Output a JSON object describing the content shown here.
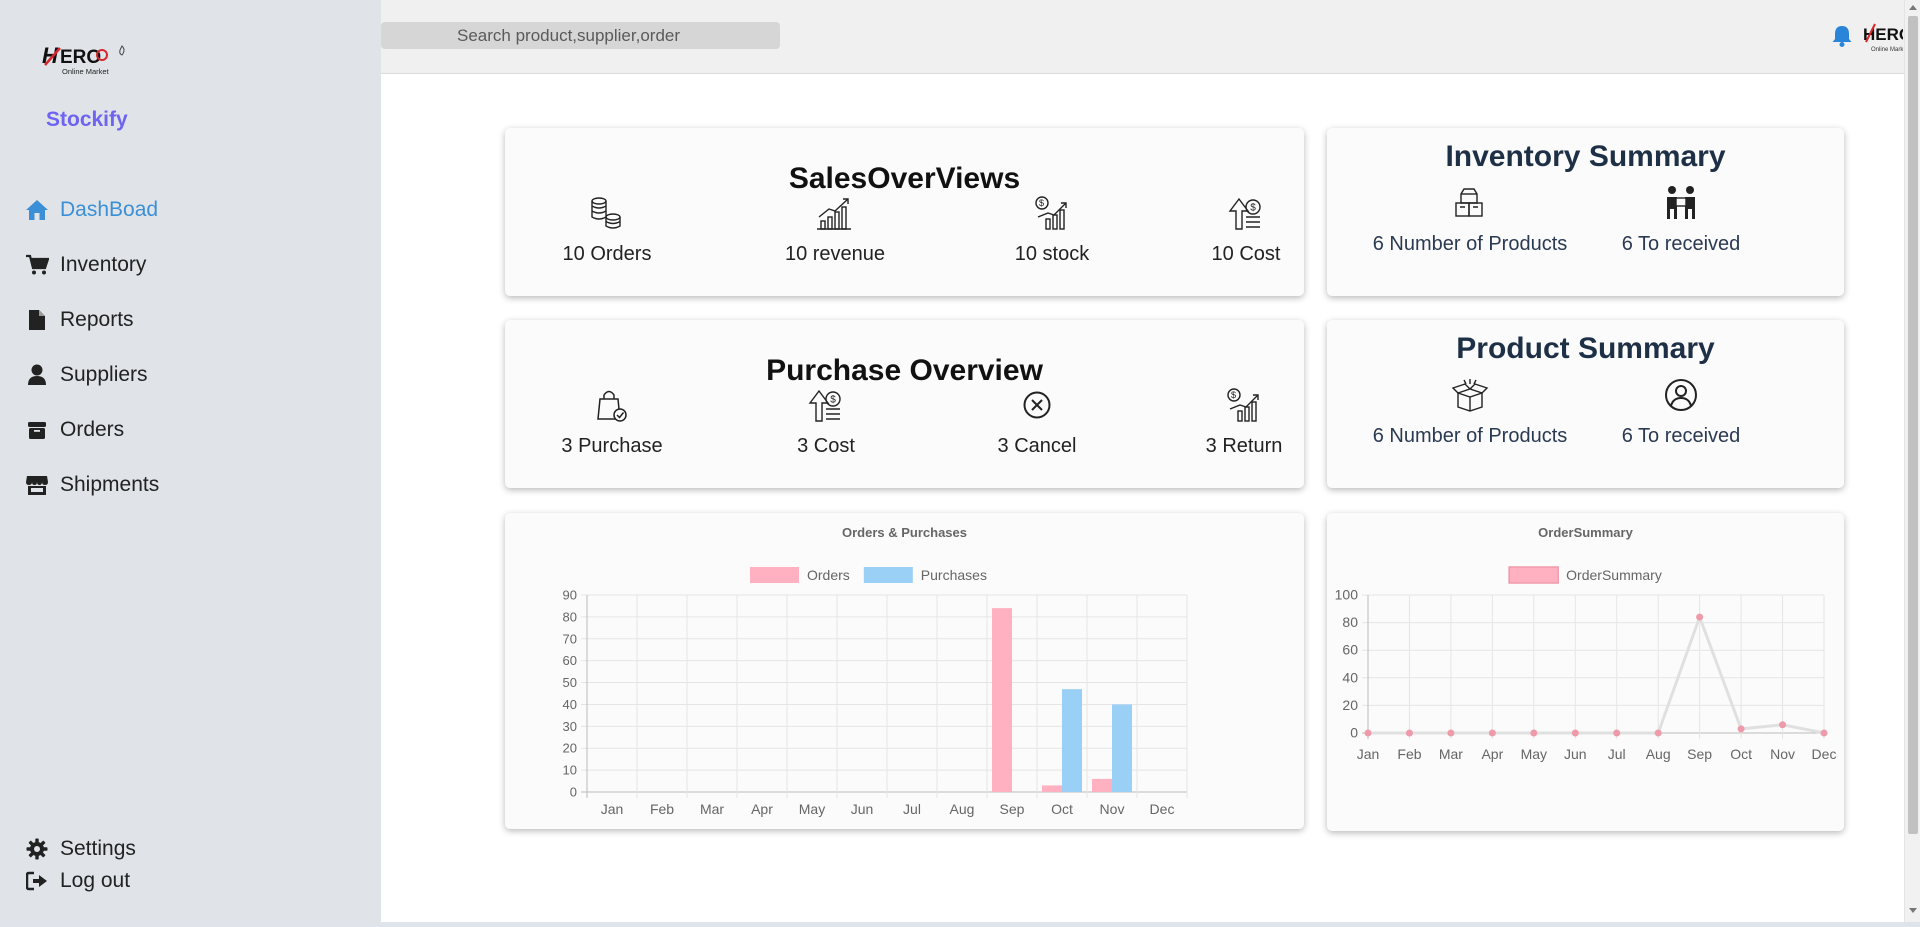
{
  "brand": {
    "name": "Stockify",
    "logo_text": "HERO",
    "logo_subtext": "Online Market"
  },
  "sidebar": {
    "items": [
      {
        "label": "DashBoad",
        "icon": "home-icon",
        "active": true
      },
      {
        "label": "Inventory",
        "icon": "cart-icon",
        "active": false
      },
      {
        "label": "Reports",
        "icon": "file-icon",
        "active": false
      },
      {
        "label": "Suppliers",
        "icon": "user-icon",
        "active": false
      },
      {
        "label": "Orders",
        "icon": "box-icon",
        "active": false
      },
      {
        "label": "Shipments",
        "icon": "store-icon",
        "active": false
      }
    ],
    "bottom": [
      {
        "label": "Settings",
        "icon": "gear-icon"
      },
      {
        "label": "Log out",
        "icon": "logout-icon"
      }
    ]
  },
  "topbar": {
    "search_placeholder": "Search product,supplier,order",
    "notification_icon": "bell-icon"
  },
  "sales_overview": {
    "title": "SalesOverViews",
    "stats": [
      {
        "label": "10 Orders",
        "icon": "coins-icon"
      },
      {
        "label": "10 revenue",
        "icon": "growth-chart-icon"
      },
      {
        "label": "10 stock",
        "icon": "money-chart-icon"
      },
      {
        "label": "10 Cost",
        "icon": "cost-up-icon"
      }
    ]
  },
  "purchase_overview": {
    "title": "Purchase Overview",
    "stats": [
      {
        "label": "3 Purchase",
        "icon": "bag-check-icon"
      },
      {
        "label": "3 Cost",
        "icon": "cost-up-icon"
      },
      {
        "label": "3 Cancel",
        "icon": "cancel-circle-icon"
      },
      {
        "label": "3 Return",
        "icon": "money-chart-icon"
      }
    ]
  },
  "inventory_summary": {
    "title": "Inventory Summary",
    "stats": [
      {
        "label": "6 Number of Products",
        "icon": "boxes-icon"
      },
      {
        "label": "6 To received",
        "icon": "delivery-person-icon"
      }
    ]
  },
  "product_summary": {
    "title": "Product Summary",
    "stats": [
      {
        "label": "6 Number of Products",
        "icon": "open-box-icon"
      },
      {
        "label": "6 To received",
        "icon": "user-circle-icon"
      }
    ]
  },
  "colors": {
    "accent": "#6e63f2",
    "active_nav": "#3b8fd6",
    "orders": "#ffb1c1",
    "purchases": "#9ad0f5",
    "order_line": "#e0e0e0",
    "order_point": "#ef9aaa"
  },
  "chart_data": [
    {
      "type": "bar",
      "title": "Orders & Purchases",
      "categories": [
        "Jan",
        "Feb",
        "Mar",
        "Apr",
        "May",
        "Jun",
        "Jul",
        "Aug",
        "Sep",
        "Oct",
        "Nov",
        "Dec"
      ],
      "series": [
        {
          "name": "Orders",
          "values": [
            0,
            0,
            0,
            0,
            0,
            0,
            0,
            0,
            84,
            3,
            6,
            0
          ]
        },
        {
          "name": "Purchases",
          "values": [
            0,
            0,
            0,
            0,
            0,
            0,
            0,
            0,
            0,
            47,
            40,
            0
          ]
        }
      ],
      "ylim": [
        0,
        90
      ],
      "yticks": [
        0,
        10,
        20,
        30,
        40,
        50,
        60,
        70,
        80,
        90
      ],
      "legend": "top",
      "grid": true
    },
    {
      "type": "line",
      "title": "OrderSummary",
      "categories": [
        "Jan",
        "Feb",
        "Mar",
        "Apr",
        "May",
        "Jun",
        "Jul",
        "Aug",
        "Sep",
        "Oct",
        "Nov",
        "Dec"
      ],
      "series": [
        {
          "name": "OrderSummary",
          "values": [
            0,
            0,
            0,
            0,
            0,
            0,
            0,
            0,
            84,
            3,
            6,
            0
          ]
        }
      ],
      "ylim": [
        0,
        100
      ],
      "yticks": [
        0,
        20,
        40,
        60,
        80,
        100
      ],
      "legend": "top",
      "grid": true
    }
  ]
}
